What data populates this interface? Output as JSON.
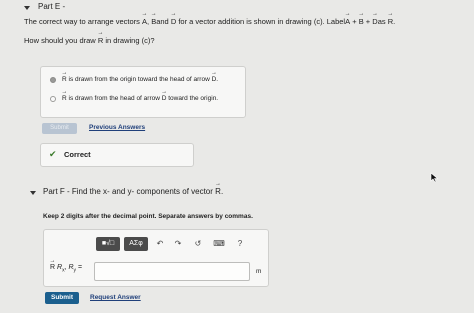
{
  "part_e": {
    "header": "Part E -",
    "question": "The correct way to arrange vectors",
    "q_a": "A",
    "q_comma": ",",
    "q_b": "B",
    "q_and": "and",
    "q_d": "D",
    "q_rest": "for a vector addition is shown in drawing (c). Label",
    "q_eq_a": "A",
    "q_plus1": "+",
    "q_eq_b": "B",
    "q_plus2": "+",
    "q_eq_d": "D",
    "q_as": "as",
    "q_eq_r": "R",
    "q_end": ".",
    "subquestion_pre": "How should you draw",
    "subquestion_r": "R",
    "subquestion_post": "in drawing (c)?",
    "options": [
      {
        "vec": "R",
        "text": "is drawn from the origin toward the head of arrow",
        "vec2": "D",
        "end": ".",
        "selected": true
      },
      {
        "vec": "R",
        "text": "is drawn from the head of arrow",
        "vec2": "D",
        "end": "toward the origin.",
        "selected": false
      }
    ],
    "submit_label": "Submit",
    "previous_answers_label": "Previous Answers",
    "feedback_check": "✔",
    "feedback_text": "Correct"
  },
  "part_f": {
    "header_pre": "Part F - Find the",
    "header_x": "x-",
    "header_and": "and",
    "header_y": "y-",
    "header_mid": "components of vector",
    "header_r": "R",
    "header_end": ".",
    "instruction": "Keep 2 digits after the decimal point. Separate answers by commas.",
    "toolbar": {
      "template_glyph": "■√□",
      "greek_label": "ΑΣφ",
      "undo": "↶",
      "redo": "↷",
      "reset": "↺",
      "keyboard": "⌨",
      "help": "?"
    },
    "input_label_vec": "R",
    "input_label": "R",
    "input_sub_x": "x",
    "input_comma": ",",
    "input_label_y": "R",
    "input_sub_y": "y",
    "input_eq": "=",
    "input_value": "",
    "unit": "m",
    "submit_label": "Submit",
    "request_answer_label": "Request Answer"
  },
  "colors": {
    "submit_bg": "#1b5f8e",
    "link": "#1f3f7a",
    "correct_check": "#3a7a2a"
  }
}
